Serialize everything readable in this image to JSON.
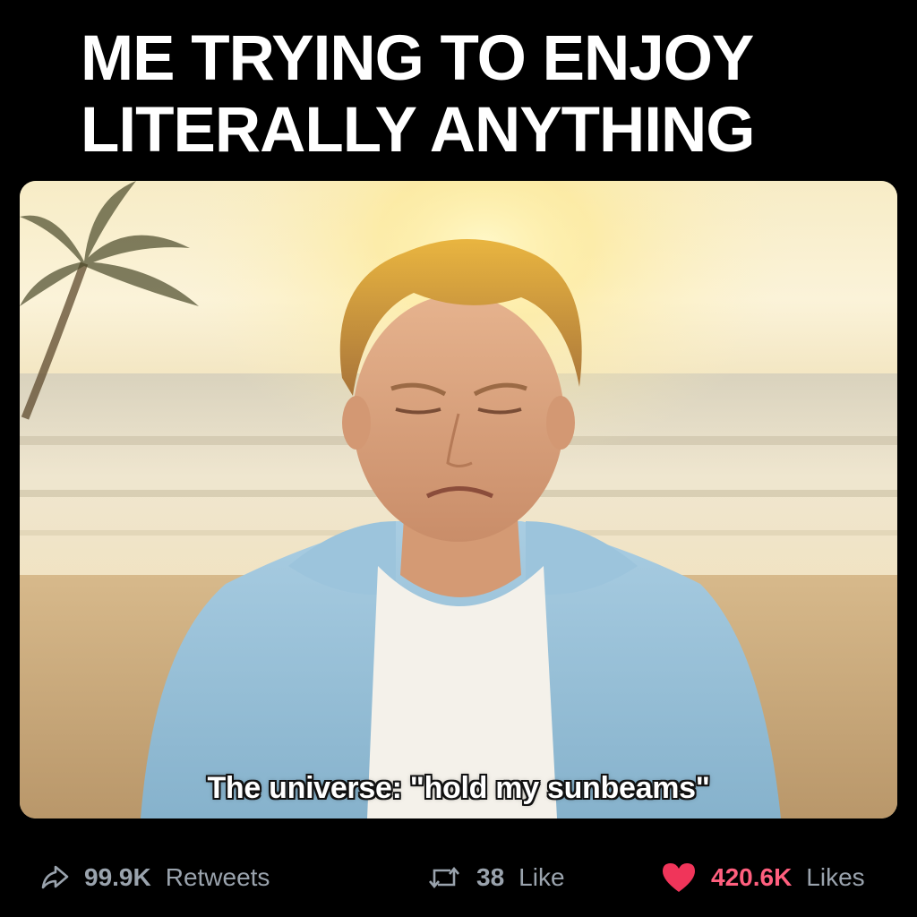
{
  "meme": {
    "title_line1": "ME TRYING TO ENJOY",
    "title_line2": "LITERALLY ANYTHING",
    "caption": "The universe: \"hold my sunbeams\""
  },
  "actions": {
    "share": {
      "icon": "share-icon",
      "count": "99.9K",
      "label": "Retweets"
    },
    "retweet": {
      "icon": "retweet-icon",
      "count": "38",
      "label": "Like"
    },
    "like": {
      "icon": "heart-icon",
      "count": "420.6K",
      "label": "Likes"
    }
  },
  "colors": {
    "background": "#000000",
    "text": "#ffffff",
    "muted": "#9aa3ad",
    "like_accent": "#ff5f7e",
    "heart": "#f0355a"
  }
}
